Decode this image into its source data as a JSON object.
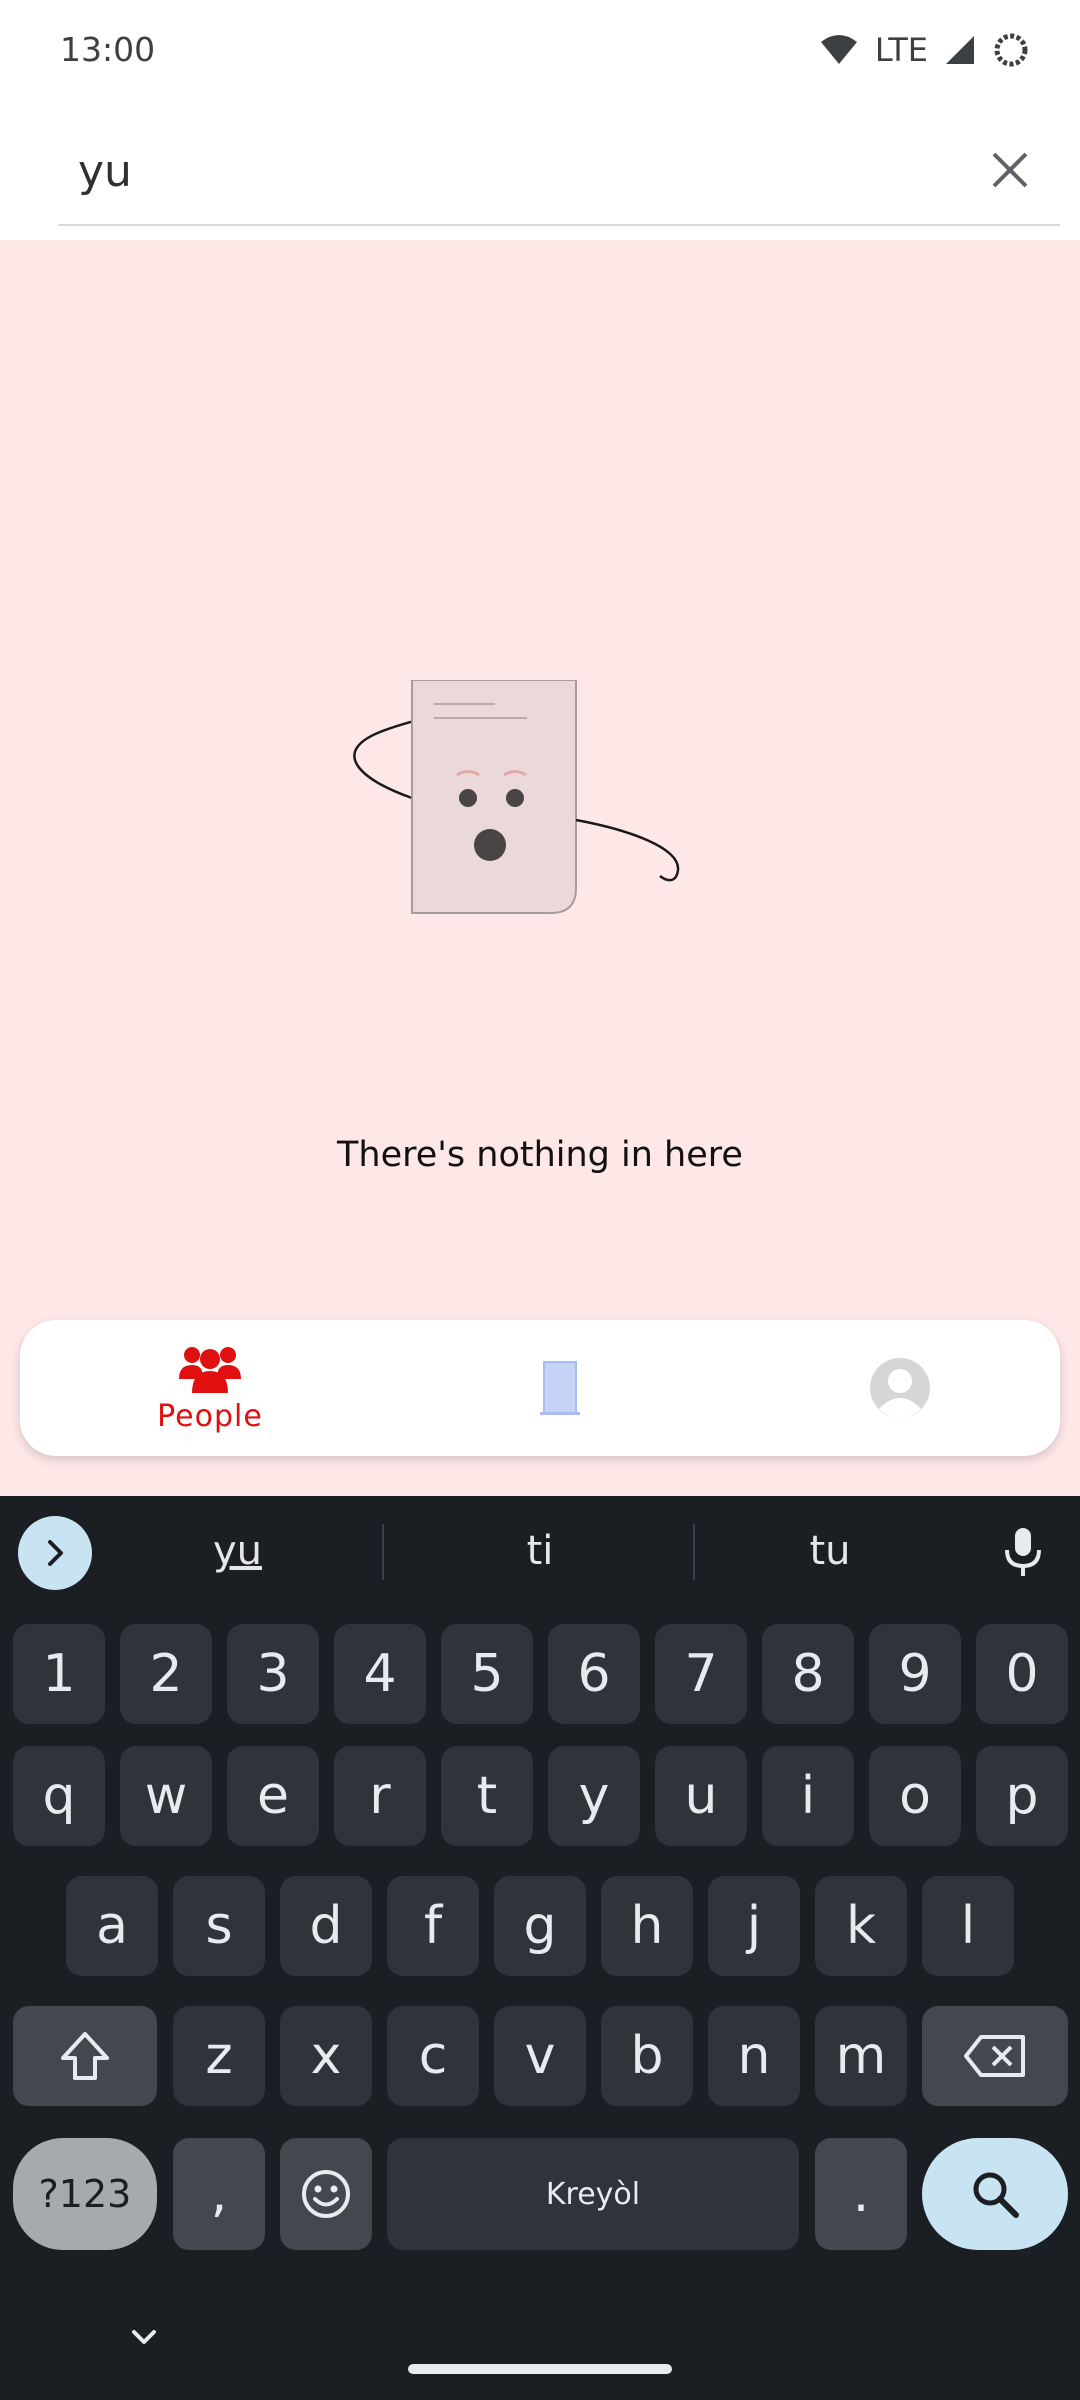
{
  "status_bar": {
    "time": "13:00",
    "network": "LTE",
    "icons": [
      "wifi-icon",
      "signal-icon",
      "battery-icon"
    ]
  },
  "search": {
    "value": "yu",
    "clear_icon": "close-icon"
  },
  "empty_state": {
    "message": "There's nothing in here",
    "illustration": "surprised-document-illustration"
  },
  "bottom_nav": {
    "items": [
      {
        "label": "People",
        "icon": "people-icon",
        "active": true
      },
      {
        "label": "",
        "icon": "door-icon",
        "active": false
      },
      {
        "label": "",
        "icon": "avatar-icon",
        "active": false
      }
    ],
    "active_color": "#e01010"
  },
  "keyboard": {
    "suggestions": [
      "yu",
      "ti",
      "tu"
    ],
    "row_numbers": [
      "1",
      "2",
      "3",
      "4",
      "5",
      "6",
      "7",
      "8",
      "9",
      "0"
    ],
    "row_top": [
      "q",
      "w",
      "e",
      "r",
      "t",
      "y",
      "u",
      "i",
      "o",
      "p"
    ],
    "row_middle": [
      "a",
      "s",
      "d",
      "f",
      "g",
      "h",
      "j",
      "k",
      "l"
    ],
    "row_bottom": [
      "z",
      "x",
      "c",
      "v",
      "b",
      "n",
      "m"
    ],
    "symbols_label": "?123",
    "comma": ",",
    "space_label": "Kreyòl",
    "period": "."
  },
  "colors": {
    "content_background": "#fde7e7",
    "keyboard_background": "#1b1f24",
    "accent": "#e01010"
  }
}
